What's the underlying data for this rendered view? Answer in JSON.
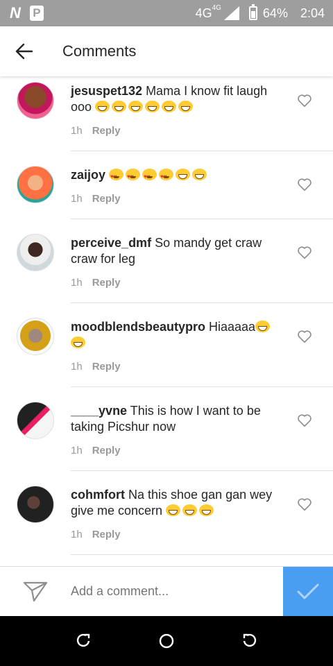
{
  "status": {
    "network": "4G",
    "network_sup": "4G",
    "battery": "64%",
    "time": "2:04"
  },
  "header": {
    "title": "Comments"
  },
  "comments": [
    {
      "user": "jesuspet132",
      "text": " Mama I know fit laugh ooo",
      "emoji": [
        "grin",
        "grin",
        "grin",
        "grin",
        "grin",
        "grin"
      ],
      "time": "1h",
      "reply": "Reply"
    },
    {
      "user": "zaijoy",
      "text": " ",
      "emoji": [
        "heart-eyes",
        "heart-eyes",
        "heart-eyes",
        "heart-eyes",
        "grin",
        "grin"
      ],
      "time": "1h",
      "reply": "Reply"
    },
    {
      "user": "perceive_dmf",
      "text": " So mandy get craw craw for leg",
      "emoji": [],
      "time": "1h",
      "reply": "Reply"
    },
    {
      "user": "moodblendsbeautypro",
      "text": " Hiaaaaa",
      "emoji": [
        "grin",
        "grin"
      ],
      "time": "1h",
      "reply": "Reply"
    },
    {
      "user": "____yvne",
      "text": " This is how I want to be taking Picshur now",
      "emoji": [],
      "time": "1h",
      "reply": "Reply"
    },
    {
      "user": "cohmfort",
      "text": " Na this shoe gan gan wey give me concern ",
      "emoji": [
        "grin",
        "grin",
        "grin"
      ],
      "time": "1h",
      "reply": "Reply"
    }
  ],
  "composer": {
    "placeholder": "Add a comment..."
  },
  "colors": {
    "accent": "#4a9ef1",
    "status_bar": "#9e9e9e"
  }
}
